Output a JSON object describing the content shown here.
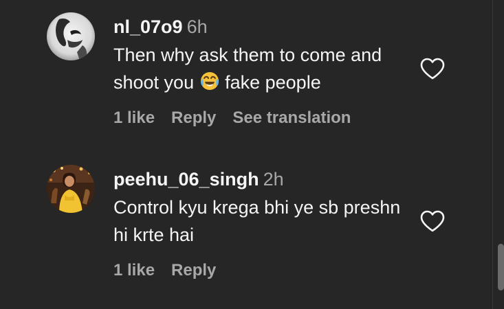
{
  "comments": [
    {
      "username": "nl_07o9",
      "time": "6h",
      "text_before_emoji": "Then why ask them to come and shoot you ",
      "emoji": "face-with-tears-of-joy",
      "text_after_emoji": " fake people",
      "likes": "1 like",
      "reply": "Reply",
      "translation": "See translation"
    },
    {
      "username": "peehu_06_singh",
      "time": "2h",
      "text": "Control kyu krega bhi ye sb preshn hi krte hai",
      "likes": "1 like",
      "reply": "Reply"
    }
  ],
  "colors": {
    "background": "#262626",
    "primary_text": "#f5f5f5",
    "secondary_text": "#a8a8a8",
    "scrollbar_thumb": "#6b6b6b"
  },
  "icons": {
    "like": "heart-outline-icon"
  }
}
